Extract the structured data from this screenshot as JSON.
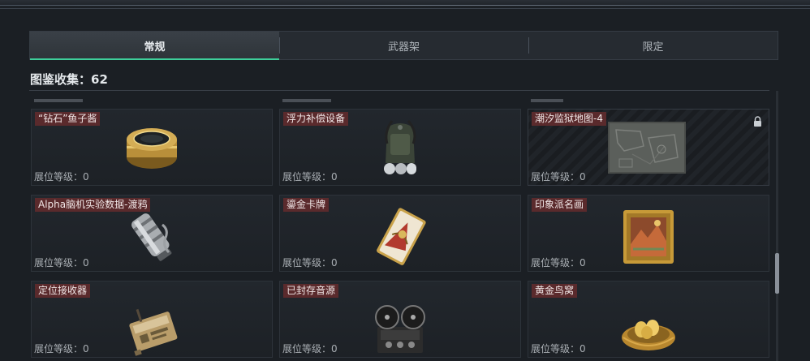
{
  "tabs": [
    {
      "label": "常规",
      "active": true
    },
    {
      "label": "武器架",
      "active": false
    },
    {
      "label": "限定",
      "active": false
    }
  ],
  "collection": {
    "label": "图鉴收集：62"
  },
  "items": [
    {
      "name": "“钻石”鱼子酱",
      "level": "展位等级：0",
      "icon": "caviar-tin-icon",
      "locked": false
    },
    {
      "name": "浮力补偿设备",
      "level": "展位等级：0",
      "icon": "buoyancy-device-icon",
      "locked": false
    },
    {
      "name": "潮汐监狱地图-4",
      "level": "展位等级：0",
      "icon": "map-icon",
      "locked": true
    },
    {
      "name": "Alpha脑机实验数据-渡鸦",
      "level": "展位等级：0",
      "icon": "data-canister-icon",
      "locked": false
    },
    {
      "name": "鎏金卡牌",
      "level": "展位等级：0",
      "icon": "gilded-card-icon",
      "locked": false
    },
    {
      "name": "印象派名画",
      "level": "展位等级：0",
      "icon": "painting-icon",
      "locked": false
    },
    {
      "name": "定位接收器",
      "level": "展位等级：0",
      "icon": "receiver-icon",
      "locked": false
    },
    {
      "name": "已封存音源",
      "level": "展位等级：0",
      "icon": "reel-recorder-icon",
      "locked": false
    },
    {
      "name": "黄金鸟窝",
      "level": "展位等级：0",
      "icon": "golden-nest-icon",
      "locked": false
    }
  ],
  "colors": {
    "accent": "#3ecf9a",
    "name_tag": "#5a2a2c"
  }
}
